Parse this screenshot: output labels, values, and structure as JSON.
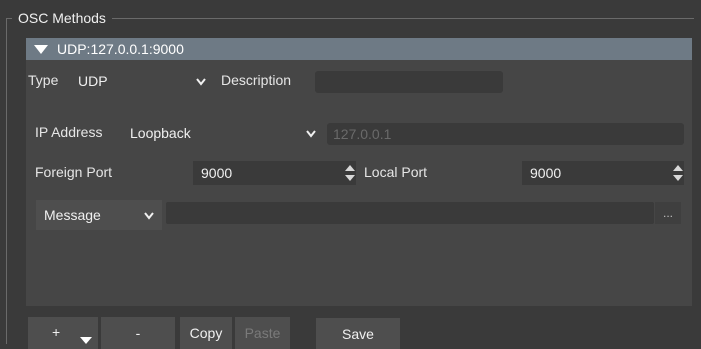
{
  "group": {
    "title": "OSC Methods"
  },
  "method": {
    "header": "UDP:127.0.0.1:9000"
  },
  "type_row": {
    "type_label": "Type",
    "type_value": "UDP",
    "description_label": "Description",
    "description_value": ""
  },
  "ip_row": {
    "label": "IP Address",
    "value": "Loopback",
    "address_value": "127.0.0.1"
  },
  "port_row": {
    "foreign_label": "Foreign Port",
    "foreign_value": "9000",
    "local_label": "Local Port",
    "local_value": "9000"
  },
  "message_row": {
    "type_value": "Message",
    "text_value": "",
    "browse_label": "..."
  },
  "toolbar": {
    "add_label": "+",
    "remove_label": "-",
    "copy_label": "Copy",
    "paste_label": "Paste",
    "save_label": "Save"
  },
  "icons": {
    "collapse": "triangle-down-icon",
    "dropdown": "chevron-down-icon",
    "spin": "spin-arrows-icon"
  },
  "colors": {
    "header_bg": "#6e7a85",
    "panel_bg": "#464646",
    "field_bg": "#3a3a3a"
  }
}
